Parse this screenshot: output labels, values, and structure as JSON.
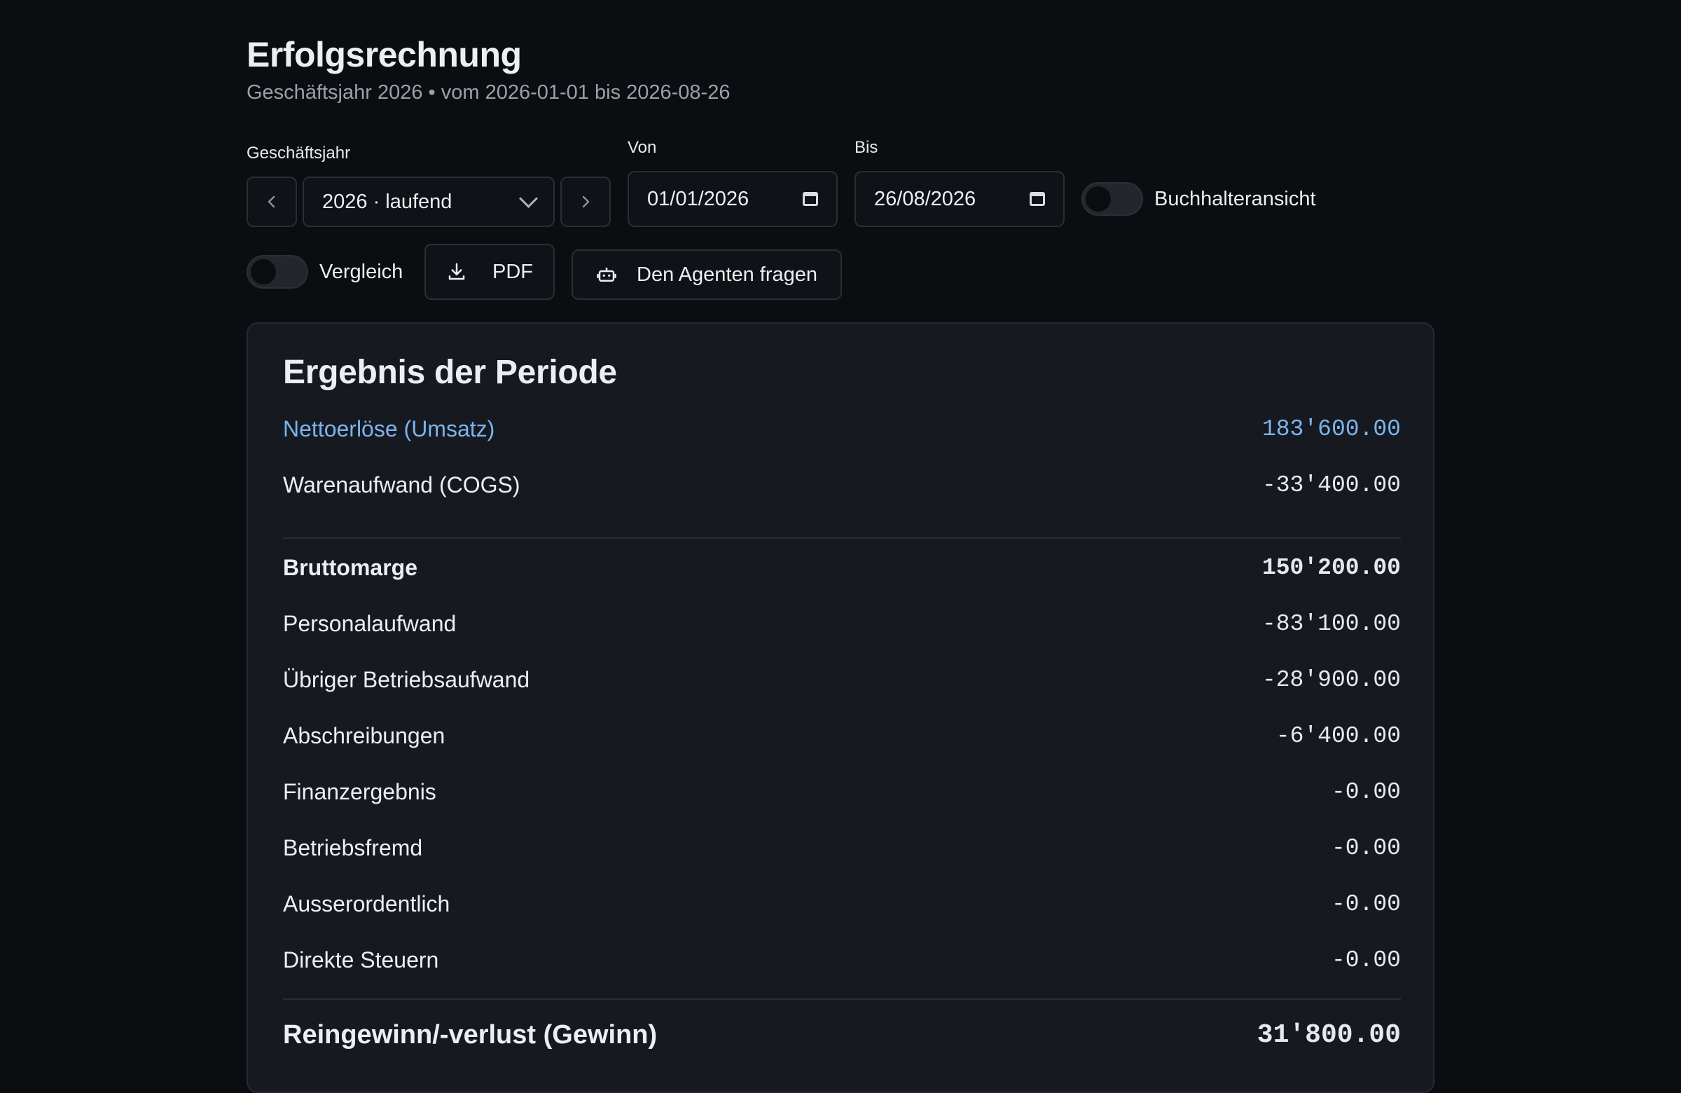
{
  "header": {
    "title": "Erfolgsrechnung",
    "subtitle": "Geschäftsjahr 2026 • vom 2026-01-01 bis 2026-08-26"
  },
  "filters": {
    "fiscal_year_label": "Geschäftsjahr",
    "fiscal_year_value": "2026 · laufend",
    "from_label": "Von",
    "from_value": "01/01/2026",
    "to_label": "Bis",
    "to_value": "26/08/2026",
    "accountant_view_label": "Buchhalteransicht",
    "accountant_view_on": false,
    "compare_label": "Vergleich",
    "compare_on": false,
    "pdf_label": "PDF",
    "agent_label": "Den Agenten fragen"
  },
  "card": {
    "title": "Ergebnis der Periode",
    "rows": [
      {
        "label": "Nettoerlöse (Umsatz)",
        "amount": "183'600.00"
      },
      {
        "label": "Warenaufwand (COGS)",
        "amount": "-33'400.00"
      },
      {
        "label": "Bruttomarge",
        "amount": "150'200.00"
      },
      {
        "label": "Personalaufwand",
        "amount": "-83'100.00"
      },
      {
        "label": "Übriger Betriebsaufwand",
        "amount": "-28'900.00"
      },
      {
        "label": "Abschreibungen",
        "amount": "-6'400.00"
      },
      {
        "label": "Finanzergebnis",
        "amount": "-0.00"
      },
      {
        "label": "Betriebsfremd",
        "amount": "-0.00"
      },
      {
        "label": "Ausserordentlich",
        "amount": "-0.00"
      },
      {
        "label": "Direkte Steuern",
        "amount": "-0.00"
      },
      {
        "label": "Reingewinn/-verlust (Gewinn)",
        "amount": "31'800.00"
      }
    ]
  },
  "colors": {
    "background": "#0c0d11",
    "card": "#161920",
    "accent": "#7cb4ec"
  }
}
